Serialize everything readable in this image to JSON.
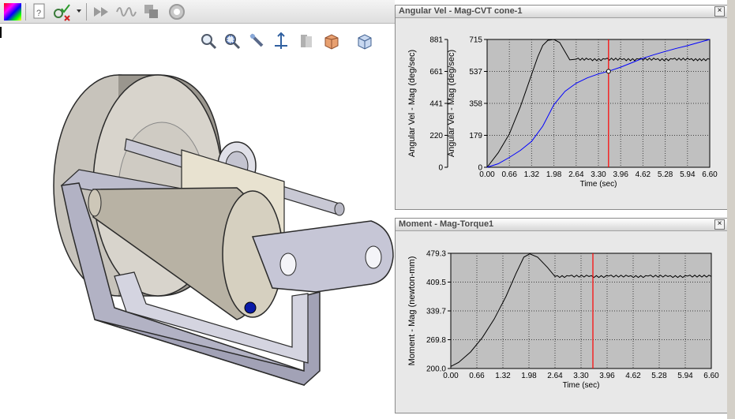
{
  "toolbar": {
    "icons": [
      "color-palette-icon",
      "document-check-icon",
      "validate-icon",
      "dropdown-arrow-icon",
      "motor-icon",
      "spring-icon",
      "contact-icon",
      "gravity-icon"
    ]
  },
  "view_tools": [
    "zoom-to-fit-icon",
    "zoom-to-area-icon",
    "previous-view-icon",
    "section-view-icon",
    "view-orientation-icon",
    "display-style-icon",
    "hide-show-icon"
  ],
  "plot1": {
    "title": "Angular Vel - Mag-CVT cone-1",
    "close_label": "×"
  },
  "plot2": {
    "title": "Moment - Mag-Torque1",
    "close_label": "×"
  },
  "chart_data": [
    {
      "type": "line",
      "title": "Angular Vel - Mag-CVT cone-1",
      "xlabel": "Time (sec)",
      "x_ticks": [
        "0.00",
        "0.66",
        "1.32",
        "1.98",
        "2.64",
        "3.30",
        "3.96",
        "4.62",
        "5.28",
        "5.94",
        "6.60"
      ],
      "xlim": [
        0,
        6.6
      ],
      "grid": true,
      "marker_time": 3.6,
      "marker_color": "#ff0000",
      "y_axes": [
        {
          "label": "Angular Vel - Mag (deg/sec)",
          "ticks": [
            "881",
            "661",
            "441",
            "220",
            "0"
          ],
          "ylim": [
            0,
            881
          ]
        },
        {
          "label": "Angular Vel - Mag (deg/sec)",
          "ticks": [
            "715",
            "537",
            "358",
            "179",
            "0"
          ],
          "ylim": [
            0,
            715
          ]
        }
      ],
      "series": [
        {
          "color": "#000000",
          "axis": 0,
          "x": [
            0,
            0.33,
            0.66,
            0.99,
            1.32,
            1.5,
            1.65,
            1.8,
            1.98,
            2.15,
            2.3,
            2.45,
            2.64,
            3.0,
            3.5,
            4.0,
            4.5,
            5.0,
            5.5,
            6.0,
            6.6
          ],
          "values": [
            0,
            100,
            230,
            420,
            640,
            760,
            840,
            875,
            881,
            860,
            800,
            740,
            745,
            742,
            745,
            742,
            745,
            742,
            745,
            742,
            744
          ]
        },
        {
          "color": "#0000ff",
          "axis": 1,
          "x": [
            0,
            0.33,
            0.66,
            0.99,
            1.32,
            1.65,
            1.98,
            2.31,
            2.64,
            2.97,
            3.3,
            3.6,
            3.96,
            4.29,
            4.62,
            4.95,
            5.28,
            5.61,
            5.94,
            6.27,
            6.6
          ],
          "values": [
            0,
            20,
            55,
            95,
            145,
            230,
            350,
            425,
            470,
            500,
            522,
            537,
            560,
            585,
            610,
            630,
            648,
            665,
            680,
            698,
            715
          ]
        }
      ]
    },
    {
      "type": "line",
      "title": "Moment - Mag-Torque1",
      "xlabel": "Time (sec)",
      "x_ticks": [
        "0.00",
        "0.66",
        "1.32",
        "1.98",
        "2.64",
        "3.30",
        "3.96",
        "4.62",
        "5.28",
        "5.94",
        "6.60"
      ],
      "xlim": [
        0,
        6.6
      ],
      "grid": true,
      "marker_time": 3.6,
      "marker_color": "#ff0000",
      "y_axes": [
        {
          "label": "Moment - Mag (newton-mm)",
          "ticks": [
            "479.3",
            "409.5",
            "339.7",
            "269.8",
            "200.0"
          ],
          "ylim": [
            200,
            479.3
          ]
        }
      ],
      "series": [
        {
          "color": "#000000",
          "axis": 0,
          "x": [
            0,
            0.2,
            0.5,
            0.8,
            1.1,
            1.4,
            1.65,
            1.85,
            2.0,
            2.2,
            2.45,
            2.64,
            3.0,
            3.5,
            4.0,
            4.5,
            5.0,
            5.5,
            6.0,
            6.6
          ],
          "values": [
            205,
            215,
            240,
            275,
            320,
            375,
            430,
            470,
            478,
            470,
            445,
            423,
            424,
            423,
            424,
            423,
            424,
            423,
            424,
            423
          ]
        }
      ]
    }
  ]
}
